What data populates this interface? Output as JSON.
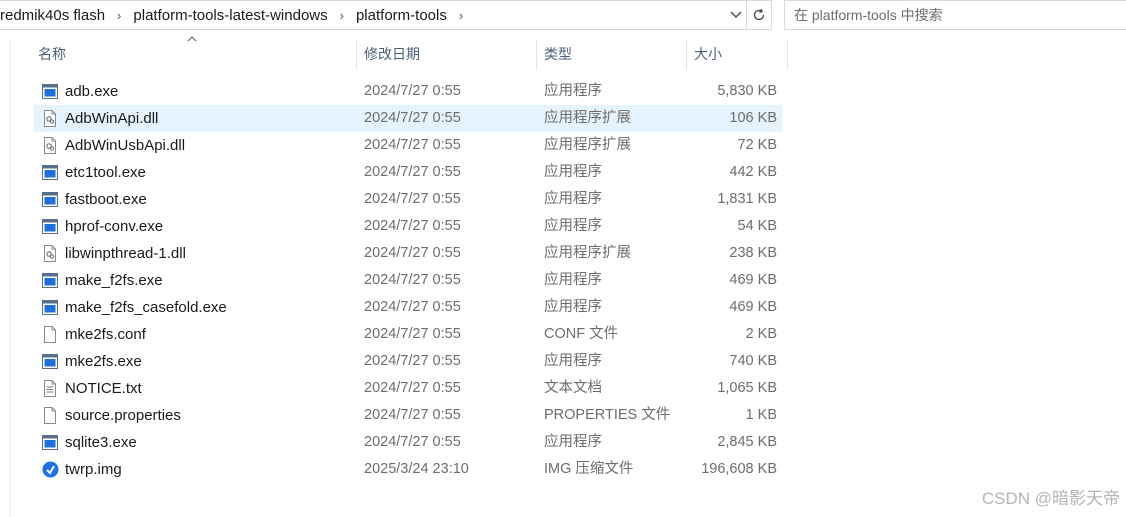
{
  "breadcrumb": [
    "redmik40s flash",
    "platform-tools-latest-windows",
    "platform-tools"
  ],
  "search": {
    "placeholder": "在 platform-tools 中搜索"
  },
  "columns": {
    "name": "名称",
    "date": "修改日期",
    "type": "类型",
    "size": "大小"
  },
  "files": [
    {
      "name": "adb.exe",
      "date": "2024/7/27 0:55",
      "type": "应用程序",
      "size": "5,830 KB",
      "icon": "exe"
    },
    {
      "name": "AdbWinApi.dll",
      "date": "2024/7/27 0:55",
      "type": "应用程序扩展",
      "size": "106 KB",
      "icon": "dll",
      "selected": true
    },
    {
      "name": "AdbWinUsbApi.dll",
      "date": "2024/7/27 0:55",
      "type": "应用程序扩展",
      "size": "72 KB",
      "icon": "dll"
    },
    {
      "name": "etc1tool.exe",
      "date": "2024/7/27 0:55",
      "type": "应用程序",
      "size": "442 KB",
      "icon": "exe"
    },
    {
      "name": "fastboot.exe",
      "date": "2024/7/27 0:55",
      "type": "应用程序",
      "size": "1,831 KB",
      "icon": "exe"
    },
    {
      "name": "hprof-conv.exe",
      "date": "2024/7/27 0:55",
      "type": "应用程序",
      "size": "54 KB",
      "icon": "exe"
    },
    {
      "name": "libwinpthread-1.dll",
      "date": "2024/7/27 0:55",
      "type": "应用程序扩展",
      "size": "238 KB",
      "icon": "dll"
    },
    {
      "name": "make_f2fs.exe",
      "date": "2024/7/27 0:55",
      "type": "应用程序",
      "size": "469 KB",
      "icon": "exe"
    },
    {
      "name": "make_f2fs_casefold.exe",
      "date": "2024/7/27 0:55",
      "type": "应用程序",
      "size": "469 KB",
      "icon": "exe"
    },
    {
      "name": "mke2fs.conf",
      "date": "2024/7/27 0:55",
      "type": "CONF 文件",
      "size": "2 KB",
      "icon": "blank"
    },
    {
      "name": "mke2fs.exe",
      "date": "2024/7/27 0:55",
      "type": "应用程序",
      "size": "740 KB",
      "icon": "exe"
    },
    {
      "name": "NOTICE.txt",
      "date": "2024/7/27 0:55",
      "type": "文本文档",
      "size": "1,065 KB",
      "icon": "txt"
    },
    {
      "name": "source.properties",
      "date": "2024/7/27 0:55",
      "type": "PROPERTIES 文件",
      "size": "1 KB",
      "icon": "blank"
    },
    {
      "name": "sqlite3.exe",
      "date": "2024/7/27 0:55",
      "type": "应用程序",
      "size": "2,845 KB",
      "icon": "exe"
    },
    {
      "name": "twrp.img",
      "date": "2025/3/24 23:10",
      "type": "IMG 压缩文件",
      "size": "196,608 KB",
      "icon": "img"
    }
  ],
  "watermark": "CSDN @暗影天帝",
  "colors": {
    "selection": "#e5f3ff",
    "header_text": "#4c607a",
    "accent": "#1a73e8"
  }
}
